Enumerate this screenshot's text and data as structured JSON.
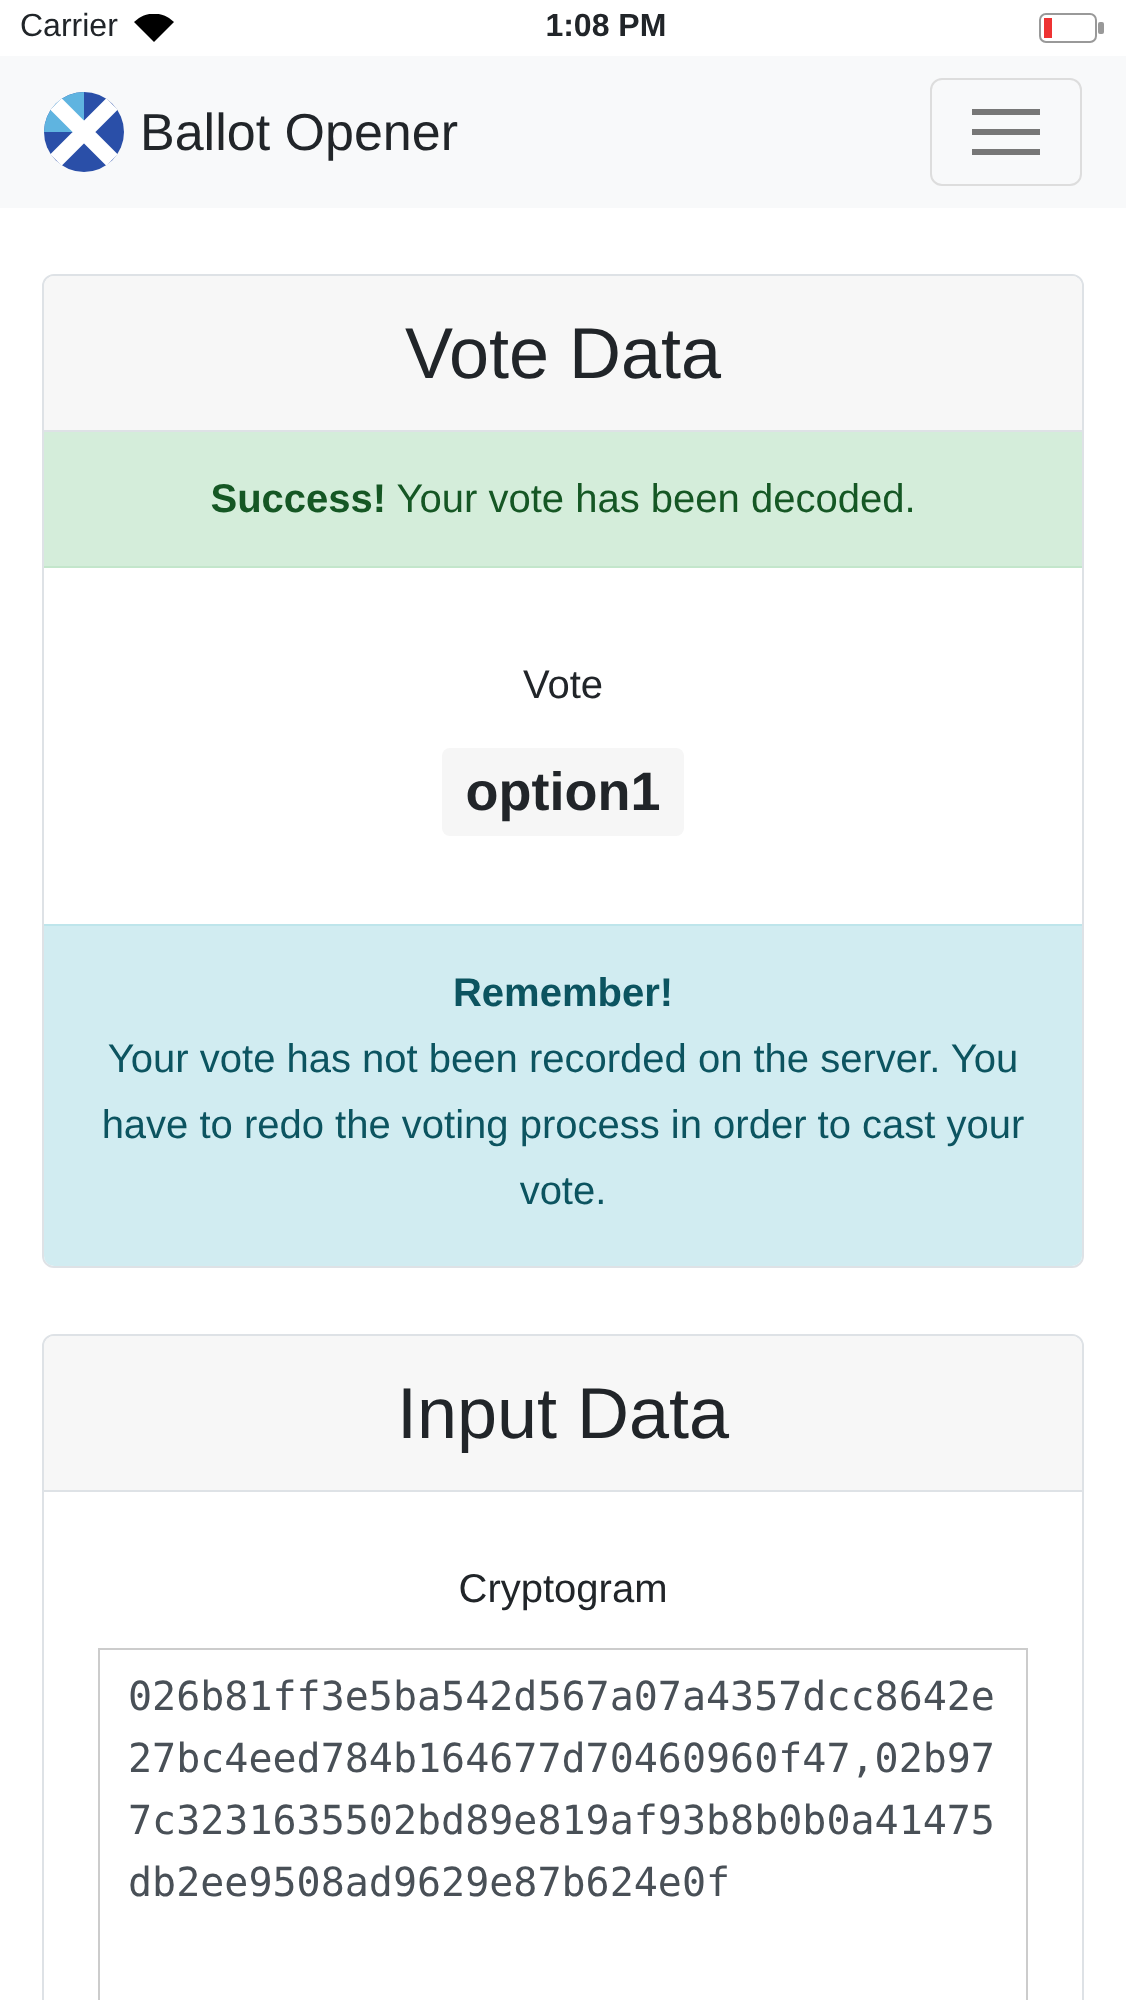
{
  "status_bar": {
    "carrier": "Carrier",
    "time": "1:08 PM"
  },
  "navbar": {
    "brand": "Ballot Opener"
  },
  "vote_card": {
    "title": "Vote Data",
    "success_alert": {
      "strong": "Success!",
      "text": "Your vote has been decoded."
    },
    "vote_label": "Vote",
    "vote_value": "option1",
    "info_alert": {
      "heading": "Remember!",
      "text": "Your vote has not been recorded on the server. You have to redo the voting process in order to cast your vote."
    }
  },
  "input_card": {
    "title": "Input Data",
    "cryptogram_label": "Cryptogram",
    "cryptogram": "026b81ff3e5ba542d567a07a4357dcc8642e27bc4eed784b164677d70460960f47,02b977c3231635502bd89e819af93b8b0b0a41475db2ee9508ad9629e87b624e0f"
  }
}
